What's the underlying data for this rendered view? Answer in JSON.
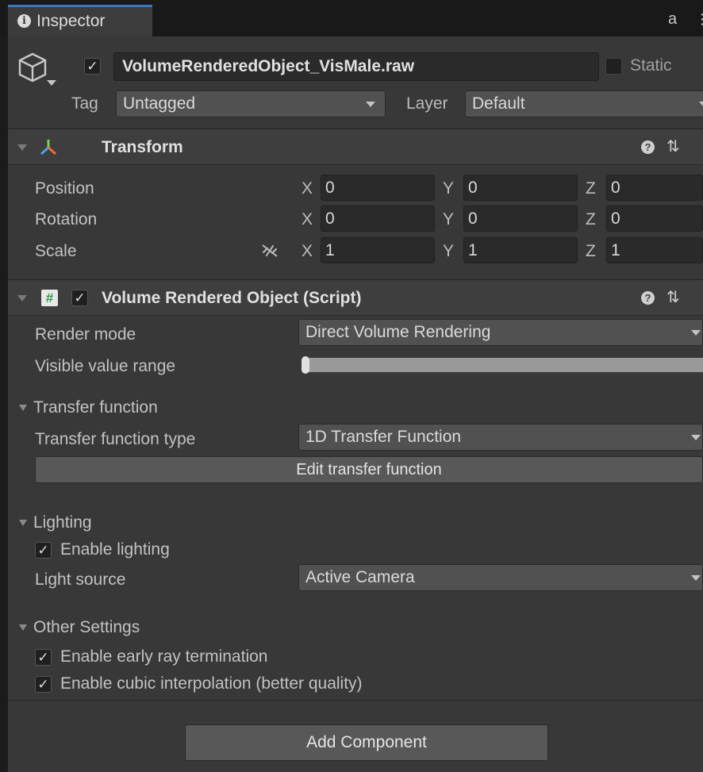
{
  "tab": {
    "label": "Inspector",
    "info_icon": "i"
  },
  "window_icons": {
    "lock": "a",
    "more": "⋮"
  },
  "header": {
    "object_name": "VolumeRenderedObject_VisMale.raw",
    "active": true,
    "static_label": "Static",
    "tag_label": "Tag",
    "tag_value": "Untagged",
    "layer_label": "Layer",
    "layer_value": "Default"
  },
  "transform": {
    "title": "Transform",
    "rows": [
      {
        "label": "Position",
        "x": "0",
        "y": "0",
        "z": "0"
      },
      {
        "label": "Rotation",
        "x": "0",
        "y": "0",
        "z": "0"
      },
      {
        "label": "Scale",
        "x": "1",
        "y": "1",
        "z": "1"
      }
    ],
    "axis_labels": {
      "x": "X",
      "y": "Y",
      "z": "Z"
    }
  },
  "script_component": {
    "title": "Volume Rendered Object (Script)",
    "enabled": true,
    "render_mode_label": "Render mode",
    "render_mode_value": "Direct Volume Rendering",
    "visible_range_label": "Visible value range",
    "visible_range": {
      "min": 0,
      "max": 1
    },
    "transfer_function": {
      "section_label": "Transfer function",
      "type_label": "Transfer function type",
      "type_value": "1D Transfer Function",
      "edit_button": "Edit transfer function"
    },
    "lighting": {
      "section_label": "Lighting",
      "enable_label": "Enable lighting",
      "enable_checked": true,
      "light_source_label": "Light source",
      "light_source_value": "Active Camera"
    },
    "other_settings": {
      "section_label": "Other Settings",
      "early_ray_label": "Enable early ray termination",
      "early_ray_checked": true,
      "cubic_label": "Enable cubic interpolation (better quality)",
      "cubic_checked": true
    }
  },
  "add_component_button": "Add Component",
  "colors": {
    "panel_bg": "#383838",
    "tab_accent": "#3a79bb",
    "field_bg": "#2a2a2a",
    "dropdown_bg": "#515151"
  }
}
